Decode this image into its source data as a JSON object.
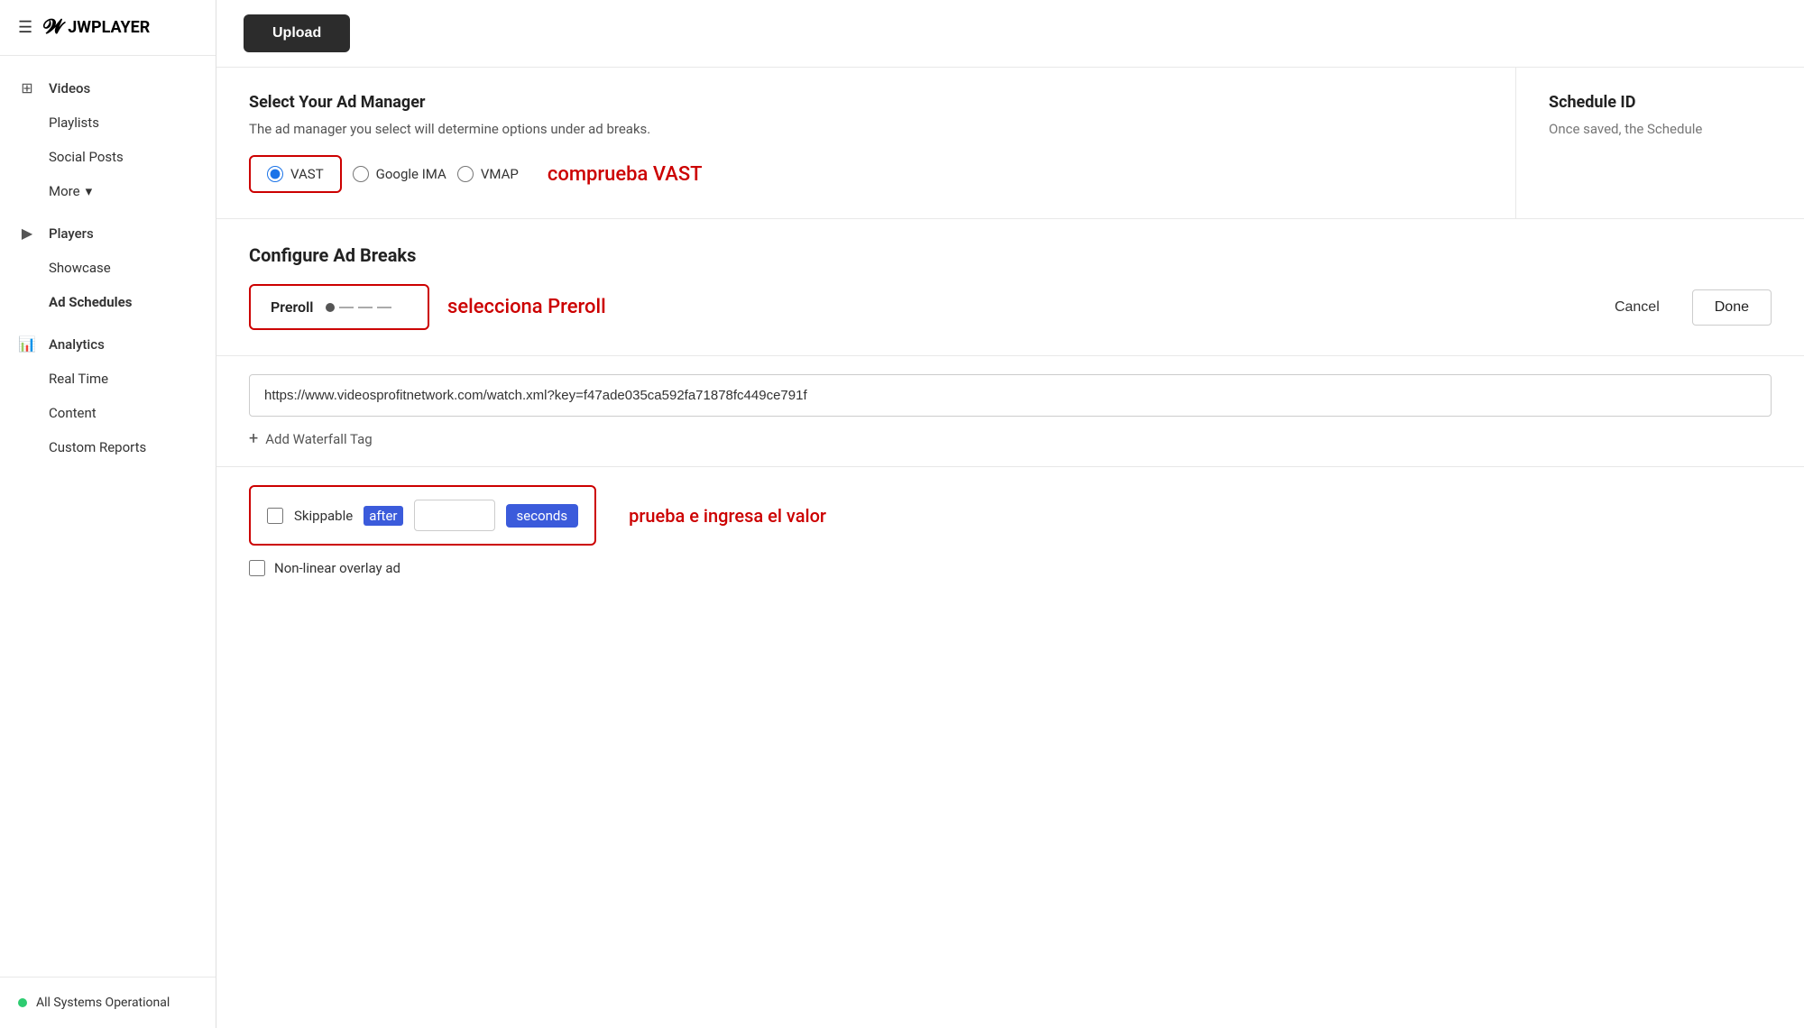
{
  "sidebar": {
    "logo": "JWPLAYER",
    "hamburger": "☰",
    "nav": [
      {
        "icon": "⊞",
        "label": "Videos",
        "type": "section"
      },
      {
        "label": "Playlists",
        "type": "item"
      },
      {
        "label": "Social Posts",
        "type": "item"
      },
      {
        "label": "More",
        "type": "more",
        "chevron": "▾"
      },
      {
        "icon": "▶",
        "label": "Players",
        "type": "section"
      },
      {
        "label": "Showcase",
        "type": "item"
      },
      {
        "label": "Ad Schedules",
        "type": "item",
        "active": true
      },
      {
        "icon": "📊",
        "label": "Analytics",
        "type": "section"
      },
      {
        "label": "Real Time",
        "type": "item"
      },
      {
        "label": "Content",
        "type": "item"
      },
      {
        "label": "Custom Reports",
        "type": "item"
      }
    ],
    "status": {
      "text": "All Systems Operational",
      "color": "#2ecc71"
    }
  },
  "topbar": {
    "upload_label": "Upload"
  },
  "top_section": {
    "left": {
      "title": "Select Your Ad Manager",
      "description": "The ad manager you select will determine options under ad breaks.",
      "radios": [
        {
          "id": "vast",
          "label": "VAST",
          "checked": true
        },
        {
          "id": "google_ima",
          "label": "Google IMA",
          "checked": false
        },
        {
          "id": "vmap",
          "label": "VMAP",
          "checked": false
        }
      ],
      "annotation": "comprueba VAST"
    },
    "right": {
      "title": "Schedule ID",
      "description": "Once saved, the Schedule"
    }
  },
  "configure_section": {
    "title": "Configure Ad Breaks",
    "preroll": {
      "label": "Preroll",
      "annotation": "selecciona Preroll"
    },
    "cancel_label": "Cancel",
    "done_label": "Done"
  },
  "url_section": {
    "url_value": "https://www.videosprofitnetwork.com/watch.xml?key=f47ade035ca592fa71878fc449ce791f",
    "waterfall_label": "+ Add Waterfall Tag"
  },
  "skip_section": {
    "label_before": "Skippable",
    "label_after": "after",
    "label_unit": "seconds",
    "input_value": "",
    "annotation": "prueba e ingresa el valor",
    "nonlinear_label": "Non-linear overlay ad"
  }
}
